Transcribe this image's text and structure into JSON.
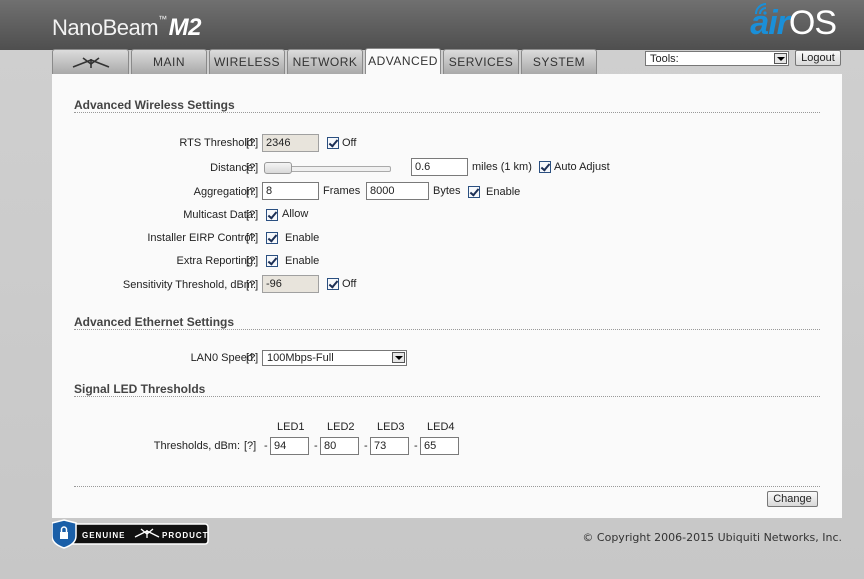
{
  "header": {
    "brand_name": "NanoBeam",
    "brand_tm": "™",
    "brand_model": "M2",
    "logo_air": "air",
    "logo_os": "OS"
  },
  "tabs": [
    {
      "label": "",
      "icon": "ubiquiti-logo-icon",
      "active": false
    },
    {
      "label": "MAIN",
      "active": false
    },
    {
      "label": "WIRELESS",
      "active": false
    },
    {
      "label": "NETWORK",
      "active": false
    },
    {
      "label": "ADVANCED",
      "active": true
    },
    {
      "label": "SERVICES",
      "active": false
    },
    {
      "label": "SYSTEM",
      "active": false
    }
  ],
  "tools": {
    "selected": "Tools:",
    "logout_label": "Logout"
  },
  "help_text": "[?]",
  "wireless": {
    "title": "Advanced Wireless Settings",
    "rts": {
      "label": "RTS Threshold:",
      "value": "2346",
      "check_label": "Off",
      "checked": true
    },
    "distance": {
      "label": "Distance:",
      "value": "0.6",
      "unit": "miles (1 km)",
      "check_label": "Auto Adjust",
      "checked": true,
      "slider_fraction": 0
    },
    "aggregation": {
      "label": "Aggregation:",
      "frames": "8",
      "frames_label": "Frames",
      "bytes": "8000",
      "bytes_label": "Bytes",
      "check_label": "Enable",
      "checked": true
    },
    "multicast": {
      "label": "Multicast Data:",
      "check_label": "Allow",
      "checked": true
    },
    "eirp": {
      "label": "Installer EIRP Control:",
      "check_label": "Enable",
      "checked": true
    },
    "extra": {
      "label": "Extra Reporting:",
      "check_label": "Enable",
      "checked": true
    },
    "sensitivity": {
      "label": "Sensitivity Threshold, dBm:",
      "value": "-96",
      "check_label": "Off",
      "checked": true
    }
  },
  "ethernet": {
    "title": "Advanced Ethernet Settings",
    "lan0": {
      "label": "LAN0 Speed:",
      "selected": "100Mbps-Full"
    }
  },
  "led": {
    "title": "Signal LED Thresholds",
    "label": "Thresholds, dBm:",
    "dash": "-",
    "headers": [
      "LED1",
      "LED2",
      "LED3",
      "LED4"
    ],
    "values": [
      "94",
      "80",
      "73",
      "65"
    ]
  },
  "change_label": "Change",
  "footer": {
    "badge_left": "GENUINE",
    "badge_right": "PRODUCT",
    "copyright": "© Copyright 2006-2015 Ubiquiti Networks, Inc."
  }
}
